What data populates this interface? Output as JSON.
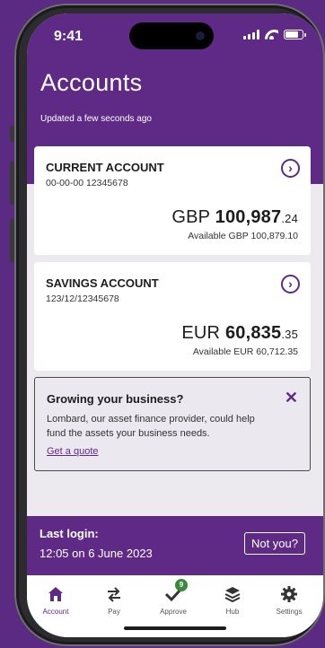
{
  "status": {
    "time": "9:41"
  },
  "header": {
    "title": "Accounts",
    "updated": "Updated a few seconds ago"
  },
  "accounts": [
    {
      "name": "CURRENT ACCOUNT",
      "number": "00-00-00  12345678",
      "currency": "GBP",
      "amount": "100,987",
      "decimals": ".24",
      "available": "Available GBP 100,879.10"
    },
    {
      "name": "SAVINGS ACCOUNT",
      "number": "123/12/12345678",
      "currency": "EUR",
      "amount": "60,835",
      "decimals": ".35",
      "available": "Available EUR 60,712.35"
    }
  ],
  "promo": {
    "title": "Growing your business?",
    "text": "Lombard, our asset finance provider, could help fund the assets your business needs.",
    "link": "Get a quote"
  },
  "login": {
    "label": "Last login:",
    "when": "12:05 on 6 June 2023",
    "button": "Not you?"
  },
  "tabs": [
    {
      "label": "Account",
      "icon": "home-icon"
    },
    {
      "label": "Pay",
      "icon": "transfer-icon"
    },
    {
      "label": "Approve",
      "icon": "check-icon",
      "badge": "9"
    },
    {
      "label": "Hub",
      "icon": "layers-icon"
    },
    {
      "label": "Settings",
      "icon": "gear-icon"
    }
  ],
  "colors": {
    "brand": "#5e2a86",
    "badge": "#3b8a3b"
  }
}
